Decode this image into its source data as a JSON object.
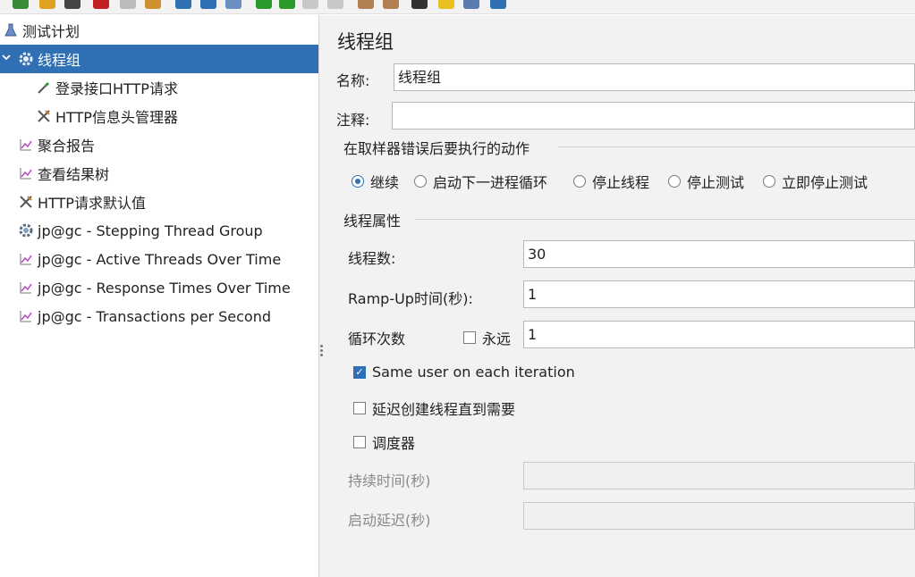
{
  "tree": {
    "items": [
      {
        "label": "测试计划",
        "icon": "flask-icon"
      },
      {
        "label": "线程组",
        "icon": "gear-icon"
      },
      {
        "label": "登录接口HTTP请求",
        "icon": "pipette-icon"
      },
      {
        "label": "HTTP信息头管理器",
        "icon": "wrench-icon"
      },
      {
        "label": "聚合报告",
        "icon": "chart-icon"
      },
      {
        "label": "查看结果树",
        "icon": "chart-icon"
      },
      {
        "label": "HTTP请求默认值",
        "icon": "wrench-icon"
      },
      {
        "label": "jp@gc - Stepping Thread Group",
        "icon": "gear-icon"
      },
      {
        "label": "jp@gc - Active Threads Over Time",
        "icon": "chart-icon"
      },
      {
        "label": "jp@gc - Response Times Over Time",
        "icon": "chart-icon"
      },
      {
        "label": "jp@gc - Transactions per Second",
        "icon": "chart-icon"
      }
    ]
  },
  "panel": {
    "title": "线程组",
    "name_label": "名称:",
    "name_value": "线程组",
    "comment_label": "注释:",
    "comment_value": "",
    "error_action": {
      "title": "在取样器错误后要执行的动作",
      "options": [
        "继续",
        "启动下一进程循环",
        "停止线程",
        "停止测试",
        "立即停止测试"
      ],
      "selected": "继续"
    },
    "thread_props": {
      "title": "线程属性",
      "threads_label": "线程数:",
      "threads_value": "30",
      "rampup_label": "Ramp-Up时间(秒):",
      "rampup_value": "1",
      "loop_label": "循环次数",
      "forever_label": "永远",
      "forever_checked": false,
      "loop_value": "1",
      "same_user_label": "Same user on each iteration",
      "same_user_checked": true,
      "delay_label": "延迟创建线程直到需要",
      "delay_checked": false,
      "scheduler_label": "调度器",
      "scheduler_checked": false,
      "duration_label": "持续时间(秒)",
      "duration_value": "",
      "startup_delay_label": "启动延迟(秒)",
      "startup_delay_value": ""
    }
  },
  "colors": {
    "selection": "#2f6fb3",
    "panel_bg": "#f2f2f2"
  }
}
